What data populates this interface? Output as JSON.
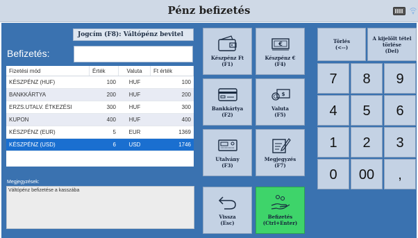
{
  "window": {
    "title": "Pénz befizetés"
  },
  "form": {
    "jogcim": "Jogcím (F8): Váltópénz bevitel",
    "befizetes_label": "Befizetés:",
    "befizetes_value": ""
  },
  "table": {
    "headers": [
      "Fizetési mód",
      "Érték",
      "Valuta",
      "Ft érték"
    ],
    "rows": [
      [
        "KÉSZPÉNZ (HUF)",
        "100",
        "HUF",
        "100"
      ],
      [
        "BANKKÁRTYA",
        "200",
        "HUF",
        "200"
      ],
      [
        "ERZS.UTALV. ÉTKEZÉSI",
        "300",
        "HUF",
        "300"
      ],
      [
        "KUPON",
        "400",
        "HUF",
        "400"
      ],
      [
        "KÉSZPÉNZ (EUR)",
        "5",
        "EUR",
        "1369"
      ],
      [
        "KÉSZPÉNZ (USD)",
        "6",
        "USD",
        "1746"
      ]
    ],
    "selected_row": 5
  },
  "notes": {
    "label": "Megjegyzések:",
    "text": "Váltópénz befizetése a kasszába"
  },
  "function_buttons": {
    "cash_ft": {
      "line1": "Készpénz Ft",
      "line2": "(F1)"
    },
    "cash_eur": {
      "line1": "Készpénz €",
      "line2": "(F4)"
    },
    "card": {
      "line1": "Bankkártya",
      "line2": "(F2)"
    },
    "currency": {
      "line1": "Valuta",
      "line2": "(F5)"
    },
    "voucher": {
      "line1": "Utalvány",
      "line2": "(F3)"
    },
    "note": {
      "line1": "Megjegyzés",
      "line2": "(F7)"
    },
    "back": {
      "line1": "Vissza",
      "line2": "(Esc)"
    },
    "finish": {
      "line1": "Befizetés",
      "line2": "(Ctrl+Enter)"
    }
  },
  "keypad": {
    "delete": {
      "line1": "Törlés",
      "line2": "(<--)"
    },
    "delete_selected": {
      "line1": "A kijelölt tétel",
      "line2": "törlése",
      "line3": "(Del)"
    },
    "keys": [
      "7",
      "8",
      "9",
      "4",
      "5",
      "6",
      "1",
      "2",
      "3",
      "0",
      "00",
      ","
    ]
  },
  "icons": {
    "keyboard": "keyboard-icon",
    "wifi": "wifi-icon",
    "wallet": "wallet-icon",
    "euro_bill": "euro-bill-icon",
    "card": "credit-card-icon",
    "currency": "currency-exchange-icon",
    "voucher": "voucher-icon",
    "note": "note-edit-icon",
    "back": "back-arrow-icon",
    "finish": "hand-coins-icon"
  },
  "colors": {
    "panel": "#3a72b0",
    "selected_row": "#1a6fd0",
    "finish_button": "#3ed46a"
  }
}
